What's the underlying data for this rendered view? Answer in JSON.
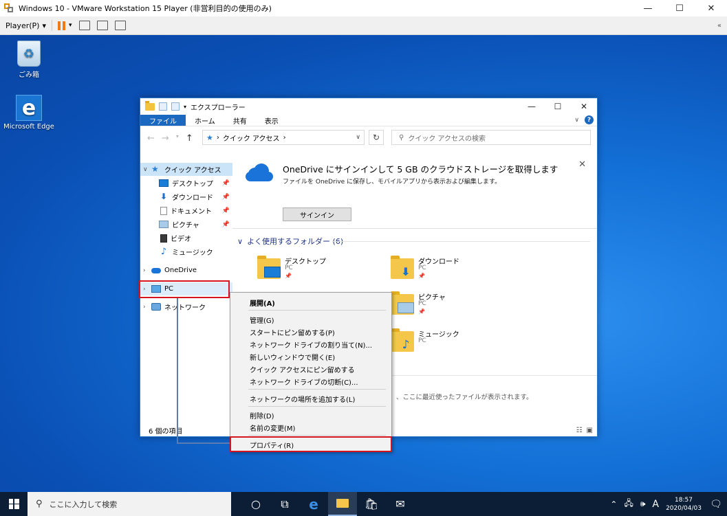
{
  "vm": {
    "title": "Windows 10 - VMware Workstation 15 Player (非営利目的の使用のみ)",
    "player_menu": "Player(P)",
    "minimize": "—",
    "maximize": "☐",
    "close": "✕",
    "collapse": "«"
  },
  "desktop": {
    "icons": [
      {
        "label": "ごみ箱",
        "icon": "recycle-bin-icon"
      },
      {
        "label": "Microsoft Edge",
        "icon": "edge-icon"
      }
    ]
  },
  "explorer": {
    "title": "エクスプローラー",
    "ribbon_tabs": [
      "ファイル",
      "ホーム",
      "共有",
      "表示"
    ],
    "address": "クイック アクセス",
    "search_placeholder": "クイック アクセスの検索",
    "nav": {
      "quick_access": "クイック アクセス",
      "items": [
        "デスクトップ",
        "ダウンロード",
        "ドキュメント",
        "ピクチャ",
        "ビデオ",
        "ミュージック"
      ],
      "onedrive": "OneDrive",
      "pc": "PC",
      "network": "ネットワーク"
    },
    "banner": {
      "title": "OneDrive にサインインして 5 GB のクラウドストレージを取得します",
      "subtitle": "ファイルを OneDrive に保存し、モバイルアプリから表示および編集します。",
      "signin": "サインイン"
    },
    "frequent_header": "よく使用するフォルダー (6)",
    "folders": [
      {
        "name": "デスクトップ",
        "location": "PC"
      },
      {
        "name": "ダウンロード",
        "location": "PC"
      },
      {
        "name": "ピクチャ",
        "location": "PC"
      },
      {
        "name": "ミュージック",
        "location": "PC"
      }
    ],
    "recent_text": "、ここに最近使ったファイルが表示されます。",
    "status": "6 個の項目"
  },
  "context_menu": {
    "items": [
      "展開(A)",
      "管理(G)",
      "スタートにピン留めする(P)",
      "ネットワーク ドライブの割り当て(N)...",
      "新しいウィンドウで開く(E)",
      "クイック アクセスにピン留めする",
      "ネットワーク ドライブの切断(C)...",
      "ネットワークの場所を追加する(L)",
      "削除(D)",
      "名前の変更(M)",
      "プロパティ(R)"
    ]
  },
  "taskbar": {
    "search_placeholder": "ここに入力して検索",
    "time": "18:57",
    "date": "2020/04/03",
    "ime": "A"
  },
  "colors": {
    "accent": "#1a68c0",
    "highlight_red": "#d6141f",
    "desktop_blue": "#1370d6"
  }
}
